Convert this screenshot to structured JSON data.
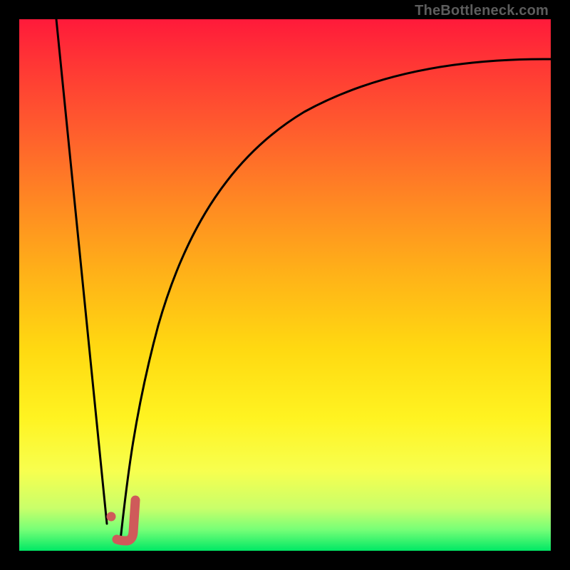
{
  "watermark": "TheBottleneck.com",
  "chart_data": {
    "type": "line",
    "title": "",
    "xlabel": "",
    "ylabel": "",
    "xlim": [
      0,
      100
    ],
    "ylim": [
      0,
      100
    ],
    "series": [
      {
        "name": "left-falling-line",
        "x": [
          7,
          16.5
        ],
        "y": [
          100,
          5
        ]
      },
      {
        "name": "right-rising-curve",
        "x": [
          19,
          22,
          26,
          32,
          40,
          50,
          62,
          76,
          88,
          100
        ],
        "y": [
          2,
          20,
          40,
          58,
          72,
          80,
          85.5,
          89,
          91,
          92.5
        ]
      }
    ],
    "marker": {
      "name": "j-marker",
      "points": [
        {
          "x": 17.3,
          "y": 6.5,
          "type": "dot"
        },
        {
          "x": 18.4,
          "y": 2.2,
          "type": "stroke-start"
        },
        {
          "x": 20.3,
          "y": 2.2,
          "type": "stroke"
        },
        {
          "x": 21.4,
          "y": 3.5,
          "type": "stroke"
        },
        {
          "x": 21.9,
          "y": 9.5,
          "type": "stroke-end"
        }
      ],
      "color": "#cf5a5a"
    },
    "gradient_stops": [
      {
        "pos": 0.0,
        "color": "#ff1a3a"
      },
      {
        "pos": 0.35,
        "color": "#ff8a22"
      },
      {
        "pos": 0.62,
        "color": "#ffd911"
      },
      {
        "pos": 0.85,
        "color": "#f7ff4f"
      },
      {
        "pos": 1.0,
        "color": "#00e865"
      }
    ]
  }
}
